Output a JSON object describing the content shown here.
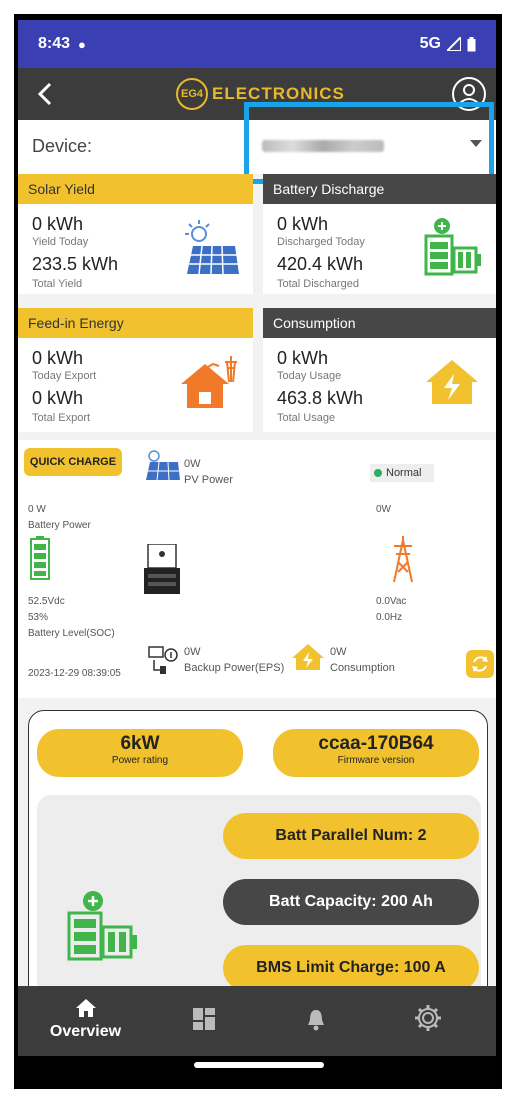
{
  "status": {
    "time": "8:43",
    "network": "5G"
  },
  "header": {
    "logo_badge": "EG4",
    "logo_text": "ELECTRONICS"
  },
  "device": {
    "label": "Device:"
  },
  "cards": {
    "solar": {
      "title": "Solar Yield",
      "v1": "0 kWh",
      "l1": "Yield Today",
      "v2": "233.5 kWh",
      "l2": "Total Yield"
    },
    "battery": {
      "title": "Battery Discharge",
      "v1": "0 kWh",
      "l1": "Discharged Today",
      "v2": "420.4 kWh",
      "l2": "Total Discharged"
    },
    "feedin": {
      "title": "Feed-in Energy",
      "v1": "0 kWh",
      "l1": "Today Export",
      "v2": "0 kWh",
      "l2": "Total Export"
    },
    "consumption": {
      "title": "Consumption",
      "v1": "0 kWh",
      "l1": "Today Usage",
      "v2": "463.8 kWh",
      "l2": "Total Usage"
    }
  },
  "flow": {
    "quick_charge": "QUICK CHARGE",
    "pv_value": "0W",
    "pv_label": "PV Power",
    "status": "Normal",
    "battery_power_value": "0 W",
    "battery_power_label": "Battery Power",
    "grid_power_value": "0W",
    "battery_voltage": "52.5Vdc",
    "battery_soc": "53%",
    "battery_level_label": "Battery Level(SOC)",
    "grid_voltage": "0.0Vac",
    "grid_freq": "0.0Hz",
    "eps_value": "0W",
    "eps_label": "Backup Power(EPS)",
    "consumption_value": "0W",
    "consumption_label": "Consumption",
    "timestamp": "2023-12-29 08:39:05"
  },
  "info": {
    "power_rating": "6kW",
    "power_rating_label": "Power rating",
    "firmware": "ccaa-170B64",
    "firmware_label": "Firmware version",
    "batt_parallel": "Batt Parallel Num: 2",
    "batt_capacity": "Batt Capacity: 200 Ah",
    "bms_limit": "BMS Limit Charge: 100 A"
  },
  "nav": {
    "overview": "Overview"
  },
  "colors": {
    "accent": "#f2c22e",
    "dark": "#3c3c3c",
    "statusbar": "#3a3fb1",
    "highlight": "#1aa3e8"
  }
}
